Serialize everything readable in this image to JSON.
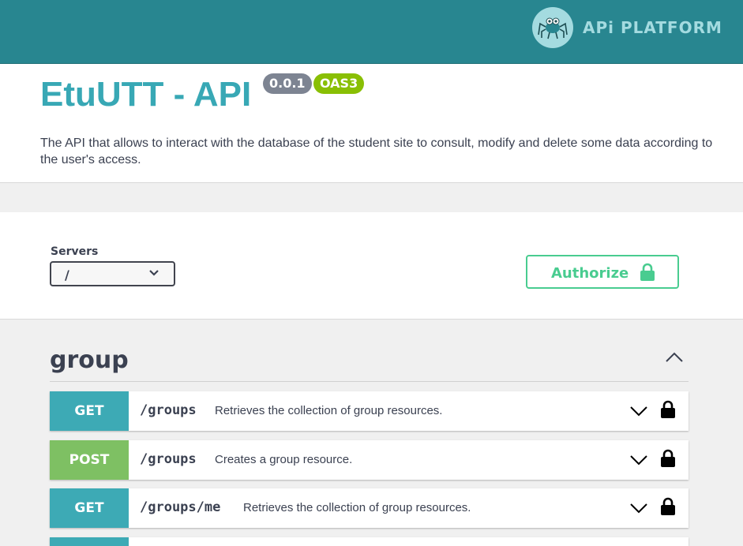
{
  "header": {
    "brand_text": "APi PLATFORM",
    "logo_icon": "spider-logo-icon",
    "colors": {
      "bar": "#288690",
      "logo": "#a4dbe0"
    }
  },
  "info": {
    "title": "EtuUTT - API",
    "version": "0.0.1",
    "spec": "OAS3",
    "description": "The API that allows to interact with the database of the student site to consult, modify and delete some data according to the user's access."
  },
  "servers": {
    "label": "Servers",
    "selected": "/"
  },
  "authorize": {
    "label": "Authorize",
    "icon": "lock-icon",
    "color": "#49cc90"
  },
  "section": {
    "title": "group",
    "toggle_icon": "chevron-up-icon"
  },
  "operations": [
    {
      "method": "GET",
      "path": "/groups",
      "summary": "Retrieves the collection of group resources."
    },
    {
      "method": "POST",
      "path": "/groups",
      "summary": "Creates a group resource."
    },
    {
      "method": "GET",
      "path": "/groups/me",
      "summary": "Retrieves the collection of group resources."
    }
  ],
  "method_colors": {
    "GET": "#3daab5",
    "POST": "#7ec063"
  }
}
